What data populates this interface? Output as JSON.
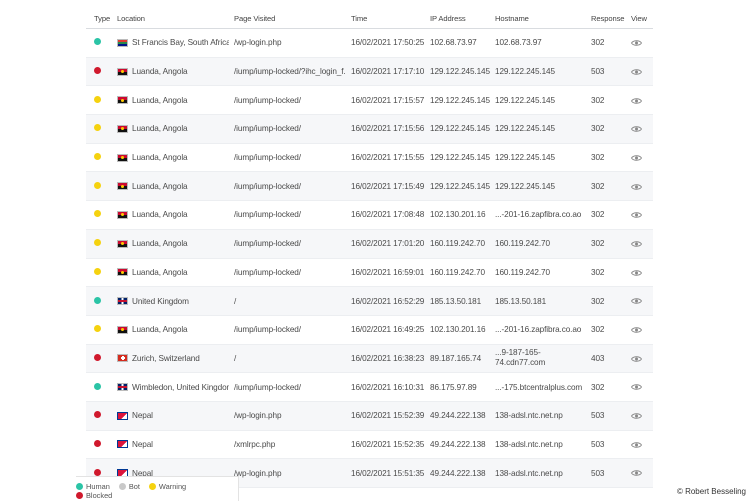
{
  "colors": {
    "Human": "#2bc4a6",
    "Bot": "#c9c9c9",
    "Warning": "#f5d20f",
    "Blocked": "#d0192d"
  },
  "headers": [
    "Type",
    "Location",
    "Page Visited",
    "Time",
    "IP Address",
    "Hostname",
    "Response",
    "View"
  ],
  "rows": [
    {
      "type": "Human",
      "flag": "za",
      "location": "St Francis Bay, South Africa",
      "page": "/wp-login.php",
      "time": "16/02/2021 17:50:25",
      "ip": "102.68.73.97",
      "host": "102.68.73.97",
      "response": "302",
      "view_icon": "eye-icon"
    },
    {
      "type": "Blocked",
      "flag": "ao",
      "location": "Luanda, Angola",
      "page": "/iump/iump-locked/?ihc_login_f...",
      "time": "16/02/2021 17:17:10",
      "ip": "129.122.245.145",
      "host": "129.122.245.145",
      "response": "503",
      "view_icon": "eye-icon"
    },
    {
      "type": "Warning",
      "flag": "ao",
      "location": "Luanda, Angola",
      "page": "/iump/iump-locked/",
      "time": "16/02/2021 17:15:57",
      "ip": "129.122.245.145",
      "host": "129.122.245.145",
      "response": "302",
      "view_icon": "eye-icon"
    },
    {
      "type": "Warning",
      "flag": "ao",
      "location": "Luanda, Angola",
      "page": "/iump/iump-locked/",
      "time": "16/02/2021 17:15:56",
      "ip": "129.122.245.145",
      "host": "129.122.245.145",
      "response": "302",
      "view_icon": "eye-icon"
    },
    {
      "type": "Warning",
      "flag": "ao",
      "location": "Luanda, Angola",
      "page": "/iump/iump-locked/",
      "time": "16/02/2021 17:15:55",
      "ip": "129.122.245.145",
      "host": "129.122.245.145",
      "response": "302",
      "view_icon": "eye-icon"
    },
    {
      "type": "Warning",
      "flag": "ao",
      "location": "Luanda, Angola",
      "page": "/iump/iump-locked/",
      "time": "16/02/2021 17:15:49",
      "ip": "129.122.245.145",
      "host": "129.122.245.145",
      "response": "302",
      "view_icon": "eye-icon"
    },
    {
      "type": "Warning",
      "flag": "ao",
      "location": "Luanda, Angola",
      "page": "/iump/iump-locked/",
      "time": "16/02/2021 17:08:48",
      "ip": "102.130.201.16",
      "host": "...-201-16.zapfibra.co.ao",
      "response": "302",
      "view_icon": "eye-icon"
    },
    {
      "type": "Warning",
      "flag": "ao",
      "location": "Luanda, Angola",
      "page": "/iump/iump-locked/",
      "time": "16/02/2021 17:01:20",
      "ip": "160.119.242.70",
      "host": "160.119.242.70",
      "response": "302",
      "view_icon": "eye-icon"
    },
    {
      "type": "Warning",
      "flag": "ao",
      "location": "Luanda, Angola",
      "page": "/iump/iump-locked/",
      "time": "16/02/2021 16:59:01",
      "ip": "160.119.242.70",
      "host": "160.119.242.70",
      "response": "302",
      "view_icon": "eye-icon"
    },
    {
      "type": "Human",
      "flag": "gb",
      "location": "United Kingdom",
      "page": "/",
      "time": "16/02/2021 16:52:29",
      "ip": "185.13.50.181",
      "host": "185.13.50.181",
      "response": "302",
      "view_icon": "eye-icon"
    },
    {
      "type": "Warning",
      "flag": "ao",
      "location": "Luanda, Angola",
      "page": "/iump/iump-locked/",
      "time": "16/02/2021 16:49:25",
      "ip": "102.130.201.16",
      "host": "...-201-16.zapfibra.co.ao",
      "response": "302",
      "view_icon": "eye-icon"
    },
    {
      "type": "Blocked",
      "flag": "ch",
      "location": "Zurich, Switzerland",
      "page": "/",
      "time": "16/02/2021 16:38:23",
      "ip": "89.187.165.74",
      "host": "...9-187-165-74.cdn77.com",
      "response": "403",
      "view_icon": "eye-icon"
    },
    {
      "type": "Human",
      "flag": "gb",
      "location": "Wimbledon, United Kingdom",
      "page": "/iump/iump-locked/",
      "time": "16/02/2021 16:10:31",
      "ip": "86.175.97.89",
      "host": "...-175.btcentralplus.com",
      "response": "302",
      "view_icon": "eye-icon"
    },
    {
      "type": "Blocked",
      "flag": "np",
      "location": "Nepal",
      "page": "/wp-login.php",
      "time": "16/02/2021 15:52:39",
      "ip": "49.244.222.138",
      "host": "138-adsl.ntc.net.np",
      "response": "503",
      "view_icon": "eye-icon"
    },
    {
      "type": "Blocked",
      "flag": "np",
      "location": "Nepal",
      "page": "/xmlrpc.php",
      "time": "16/02/2021 15:52:35",
      "ip": "49.244.222.138",
      "host": "138-adsl.ntc.net.np",
      "response": "503",
      "view_icon": "eye-icon"
    },
    {
      "type": "Blocked",
      "flag": "np",
      "location": "Nepal",
      "page": "/wp-login.php",
      "time": "16/02/2021 15:51:35",
      "ip": "49.244.222.138",
      "host": "138-adsl.ntc.net.np",
      "response": "503",
      "view_icon": "eye-icon"
    }
  ],
  "legend": [
    "Human",
    "Bot",
    "Warning",
    "Blocked"
  ],
  "credit": "© Robert Besseling"
}
